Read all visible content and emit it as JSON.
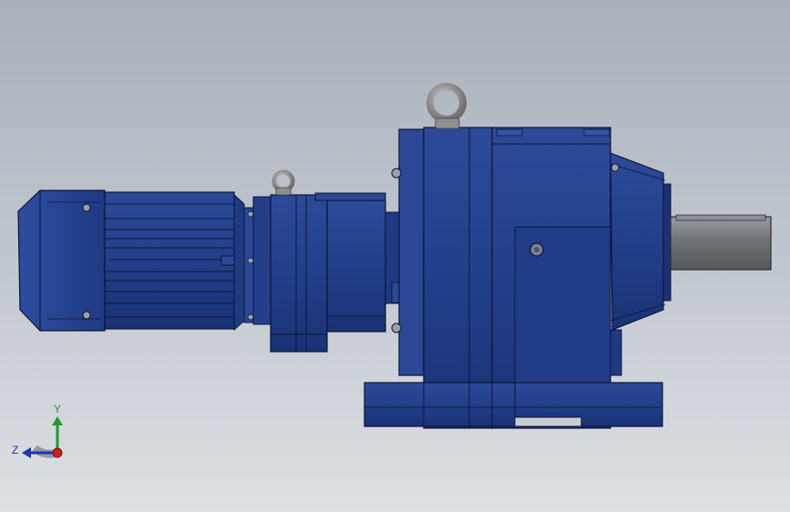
{
  "viewport": {
    "background_top": "#a7b0bb",
    "background_bottom": "#dde1e5"
  },
  "model": {
    "body_color": "#223f8a",
    "body_shade": "#1a3275",
    "body_highlight": "#3355a5",
    "edge_color": "#0c1536",
    "shaft_color": "#7b7e84",
    "lifting_eye_color": "#8c8c8c"
  },
  "triad": {
    "x_color": "#cc1f1f",
    "y_color": "#1f9a2c",
    "z_color": "#1f33b5",
    "y_label": "Y",
    "z_label": "Z"
  }
}
